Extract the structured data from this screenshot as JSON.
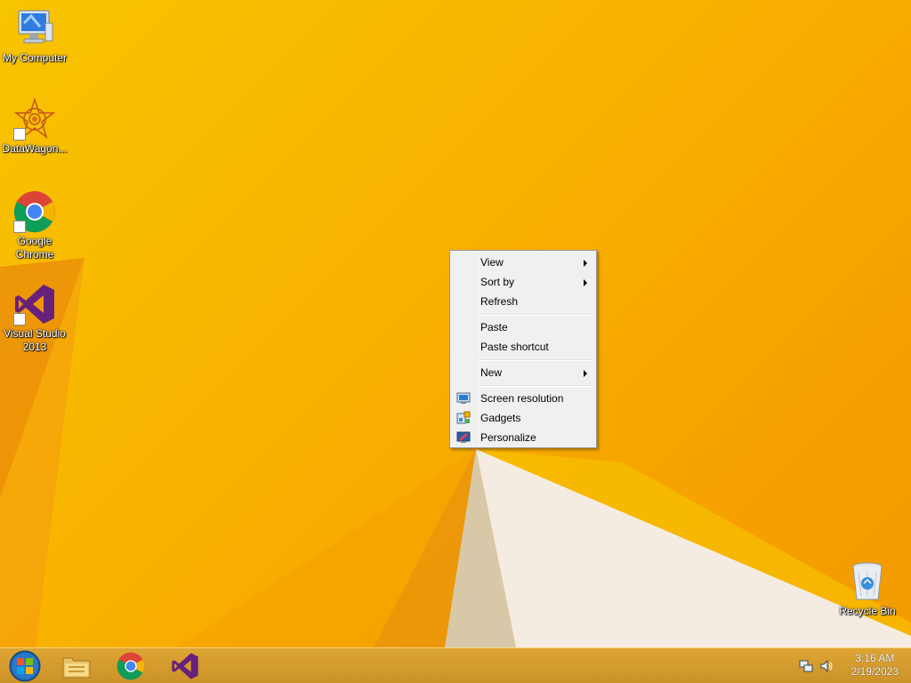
{
  "desktop": {
    "icons": [
      {
        "label": "My Computer",
        "icon": "computer-icon"
      },
      {
        "label": "DataWagon...",
        "icon": "datawagon-icon"
      },
      {
        "label": "Google Chrome",
        "icon": "chrome-icon"
      },
      {
        "label": "Visual Studio 2013",
        "icon": "visual-studio-icon"
      },
      {
        "label": "Recycle Bin",
        "icon": "recycle-bin-icon"
      }
    ]
  },
  "context_menu": {
    "items": [
      {
        "label": "View",
        "has_submenu": true
      },
      {
        "label": "Sort by",
        "has_submenu": true
      },
      {
        "label": "Refresh"
      },
      {
        "label": "Paste"
      },
      {
        "label": "Paste shortcut"
      },
      {
        "label": "New",
        "has_submenu": true
      },
      {
        "label": "Screen resolution",
        "icon": "screen-resolution-icon"
      },
      {
        "label": "Gadgets",
        "icon": "gadgets-icon"
      },
      {
        "label": "Personalize",
        "icon": "personalize-icon"
      }
    ]
  },
  "taskbar": {
    "buttons": [
      {
        "icon": "start-orb-icon"
      },
      {
        "icon": "file-explorer-icon"
      },
      {
        "icon": "chrome-icon"
      },
      {
        "icon": "visual-studio-icon"
      }
    ],
    "tray": {
      "icons": [
        "network-icon",
        "volume-icon"
      ],
      "time": "3:16 AM",
      "date": "2/19/2023"
    }
  },
  "colors": {
    "wallpaper": "#f7b500",
    "menu_bg": "#f0f0f0",
    "menu_border": "#979797"
  }
}
